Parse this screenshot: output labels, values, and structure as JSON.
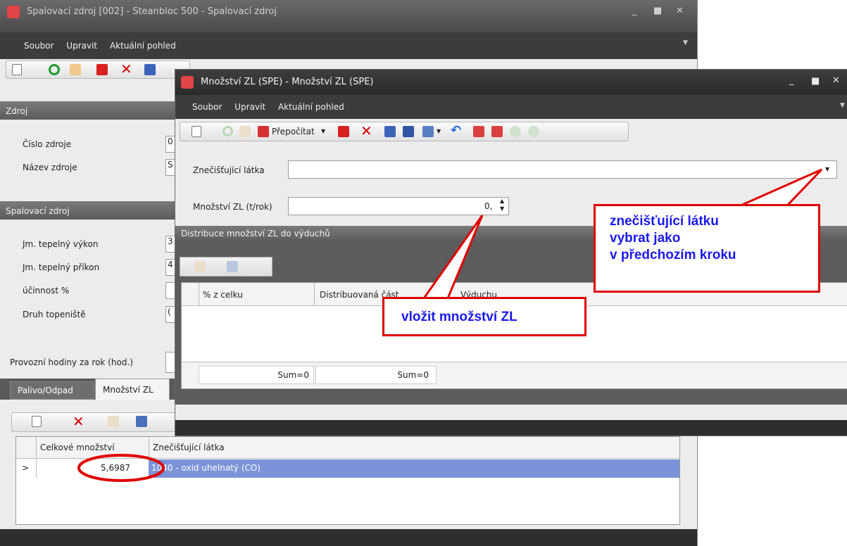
{
  "main_window": {
    "title": "Spalovací zdroj [002] - Steanbloc 500 - Spalovací zdroj",
    "menu": [
      "Soubor",
      "Upravit",
      "Aktuální pohled"
    ],
    "section_source": "Zdroj",
    "fields_source": [
      {
        "label": "Číslo zdroje",
        "value": "0"
      },
      {
        "label": "Název zdroje",
        "value": "S"
      }
    ],
    "section_combustion": "Spalovací zdroj",
    "fields_combustion": [
      {
        "label": "Jm. tepelný výkon",
        "value": "3"
      },
      {
        "label": "Jm. tepelný příkon",
        "value": "4"
      },
      {
        "label": "účinnost %",
        "value": ""
      },
      {
        "label": "Druh topeniště",
        "value": "("
      }
    ],
    "operating_hours_label": "Provozní hodiny za rok (hod.)",
    "tabs": [
      "Palivo/Odpad",
      "Množství ZL"
    ],
    "grid": {
      "columns": [
        "Celkové množství",
        "Znečišťující látka"
      ],
      "rows": [
        {
          "marker": ">",
          "total": "5,6987",
          "pollutant": "1040 - oxid uhelnatý (CO)"
        }
      ]
    }
  },
  "dialog": {
    "title": "Množství ZL (SPE) - Množství ZL (SPE)",
    "menu": [
      "Soubor",
      "Upravit",
      "Aktuální pohled"
    ],
    "recalc_label": "Přepočítat",
    "pollutant_label": "Znečišťující látka",
    "pollutant_value": "",
    "amount_label": "Množství ZL (t/rok)",
    "amount_value": "0,",
    "distribution_section": "Distribuce množství ZL do výduchů",
    "dist_columns": [
      "% z celku",
      "Distribuovaná část",
      "Výduchu"
    ],
    "sum_left": "Sum=0",
    "sum_right": "Sum=0"
  },
  "callouts": {
    "pollutant_note": [
      "znečišťující látku",
      "vybrat jako",
      "v předchozím kroku"
    ],
    "amount_note": "vložit množství ZL"
  },
  "colors": {
    "highlight_row": "#7b93d8",
    "callout_border": "#e00000",
    "callout_text": "#1a1aee",
    "dark_chrome": "#3c3c3c"
  }
}
